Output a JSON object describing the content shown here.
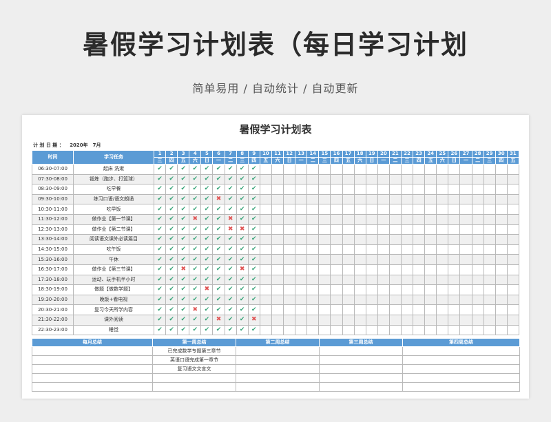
{
  "hero": {
    "title": "暑假学习计划表（每日学习计划",
    "subtitle": "简单易用 / 自动统计 / 自动更新"
  },
  "sheet": {
    "title": "暑假学习计划表",
    "date_label": "计 划 日 期 ：",
    "date_value": "2020年　7月"
  },
  "header": {
    "time": "时间",
    "task": "学习任务"
  },
  "days": [
    "1",
    "2",
    "3",
    "4",
    "5",
    "6",
    "7",
    "8",
    "9",
    "10",
    "11",
    "12",
    "13",
    "14",
    "15",
    "16",
    "17",
    "18",
    "19",
    "20",
    "21",
    "22",
    "23",
    "24",
    "25",
    "26",
    "27",
    "28",
    "29",
    "30",
    "31"
  ],
  "weekdays": [
    "三",
    "四",
    "五",
    "六",
    "日",
    "一",
    "二",
    "三",
    "四",
    "五",
    "六",
    "日",
    "一",
    "二",
    "三",
    "四",
    "五",
    "六",
    "日",
    "一",
    "二",
    "三",
    "四",
    "五",
    "六",
    "日",
    "一",
    "二",
    "三",
    "四",
    "五"
  ],
  "marks": {
    "done": "✔",
    "missed": "✖"
  },
  "rows": [
    {
      "time": "06:30-07:00",
      "task": "起床 洗漱",
      "status": "vvvvvvvvv"
    },
    {
      "time": "07:30-08:00",
      "task": "锻炼（跑步、打篮球）",
      "status": "vvvvvvvvv"
    },
    {
      "time": "08:30-09:00",
      "task": "吃早餐",
      "status": "vvvvvvvvv"
    },
    {
      "time": "09:30-10:00",
      "task": "练习口语/语文朗诵",
      "status": "vvvvvxvvv"
    },
    {
      "time": "10:30-11:00",
      "task": "吃早饭",
      "status": "vvvvvvvvv"
    },
    {
      "time": "11:30-12:00",
      "task": "做作业【第一节课】",
      "status": "vvvxvvxvv"
    },
    {
      "time": "12:30-13:00",
      "task": "做作业【第二节课】",
      "status": "vvvvvvxxv"
    },
    {
      "time": "13:30-14:00",
      "task": "阅读语文课外必读篇目",
      "status": "vvvvvvvvv"
    },
    {
      "time": "14:30-15:00",
      "task": "吃午饭",
      "status": "vvvvvvvvv"
    },
    {
      "time": "15:30-16:00",
      "task": "午休",
      "status": "vvvvvvvvv"
    },
    {
      "time": "16:30-17:00",
      "task": "做作业【第三节课】",
      "status": "vvxvvvvxv"
    },
    {
      "time": "17:30-18:00",
      "task": "运动、玩手机半小时",
      "status": "vvvvvvvvv"
    },
    {
      "time": "18:30-19:00",
      "task": "做题【做数学题】",
      "status": "vvvvxvvvv"
    },
    {
      "time": "19:30-20:00",
      "task": "晚饭+看电视",
      "status": "vvvvvvvvv"
    },
    {
      "time": "20:30-21:00",
      "task": "复习今天所学内容",
      "status": "vvvxvvvvv"
    },
    {
      "time": "21:30-22:00",
      "task": "课外阅读",
      "status": "vvvvvxvvx"
    },
    {
      "time": "22:30-23:00",
      "task": "睡觉",
      "status": "vvvvvvvvv"
    }
  ],
  "summary": {
    "headers": [
      "每月总结",
      "第一周总结",
      "第二周总结",
      "第三周总结",
      "第四周总结"
    ],
    "week1": [
      "已完成数学专题第三章节",
      "英语口语完成第一章节",
      "复习语文文言文",
      "",
      ""
    ]
  }
}
